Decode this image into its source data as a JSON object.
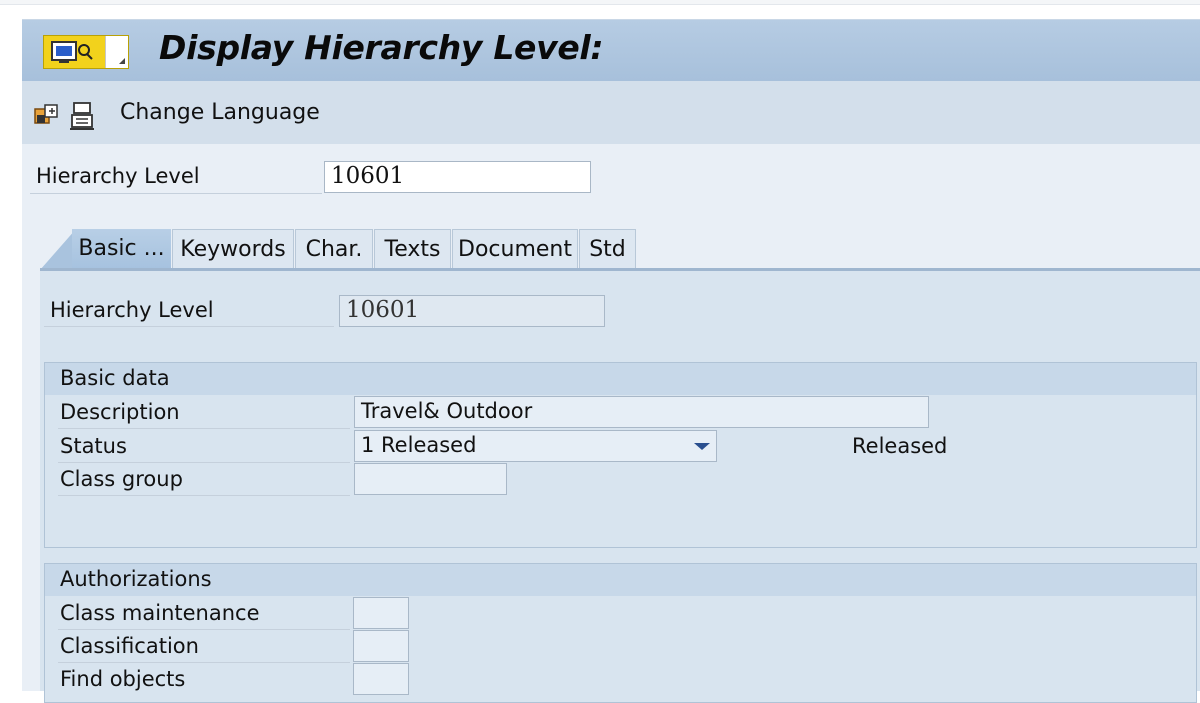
{
  "window": {
    "title": "Display Hierarchy Level:"
  },
  "toolbar": {
    "change_language_label": "Change Language"
  },
  "header": {
    "hierarchy_level_label": "Hierarchy Level",
    "hierarchy_level_value": "10601"
  },
  "tabs": [
    {
      "label": "Basic ...",
      "active": true
    },
    {
      "label": "Keywords",
      "active": false
    },
    {
      "label": "Char.",
      "active": false
    },
    {
      "label": "Texts",
      "active": false
    },
    {
      "label": "Document",
      "active": false
    },
    {
      "label": "Std",
      "active": false
    }
  ],
  "tab_content": {
    "hierarchy_level_label": "Hierarchy Level",
    "hierarchy_level_value": "10601",
    "basic_data": {
      "title": "Basic data",
      "description_label": "Description",
      "description_value": "Travel& Outdoor",
      "status_label": "Status",
      "status_value": "1 Released",
      "status_text": "Released",
      "class_group_label": "Class group",
      "class_group_value": ""
    },
    "authorizations": {
      "title": "Authorizations",
      "class_maintenance_label": "Class maintenance",
      "classification_label": "Classification",
      "find_objects_label": "Find objects"
    }
  },
  "colors": {
    "title_bar": "#a7c0db",
    "toolbar": "#d3dfeb",
    "panel": "#d8e4ef",
    "dropdown_arrow": "#2a4f8f"
  }
}
